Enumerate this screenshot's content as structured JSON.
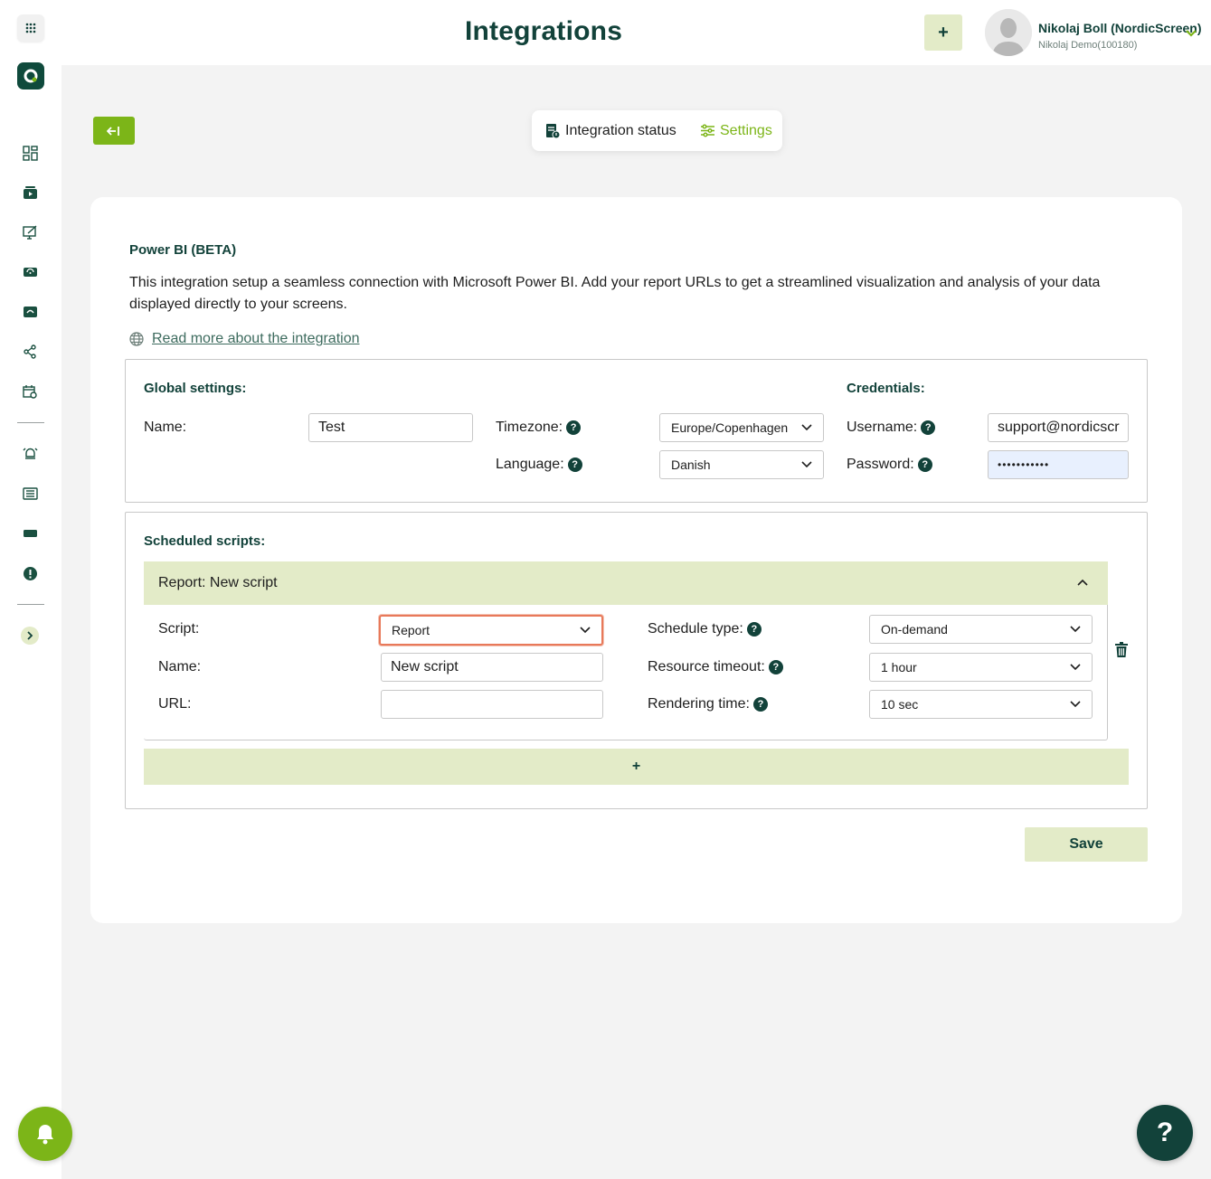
{
  "header": {
    "title": "Integrations",
    "add_label": "+",
    "user_name": "Nikolaj Boll (NordicScreen)",
    "user_sub": "Nikolaj Demo(100180)"
  },
  "tabs": {
    "status_label": "Integration status",
    "settings_label": "Settings"
  },
  "integration": {
    "title": "Power BI (BETA)",
    "description": "This integration setup a seamless connection with Microsoft Power BI. Add your report URLs to get a streamlined visualization and analysis of your data displayed directly to your screens.",
    "read_more": "Read more about the integration"
  },
  "global": {
    "title": "Global settings:",
    "name_label": "Name:",
    "name_value": "Test",
    "timezone_label": "Timezone:",
    "timezone_value": "Europe/Copenhagen",
    "language_label": "Language:",
    "language_value": "Danish"
  },
  "credentials": {
    "title": "Credentials:",
    "username_label": "Username:",
    "username_value": "support@nordicscr",
    "password_label": "Password:",
    "password_value": "•••••••••••"
  },
  "scheduled": {
    "title": "Scheduled scripts:",
    "header_label": "Report:",
    "header_name": "New script",
    "script_label": "Script:",
    "script_value": "Report",
    "name_label": "Name:",
    "name_value": "New script",
    "url_label": "URL:",
    "url_value": "",
    "schedule_type_label": "Schedule type:",
    "schedule_type_value": "On-demand",
    "resource_timeout_label": "Resource timeout:",
    "resource_timeout_value": "1 hour",
    "rendering_time_label": "Rendering time:",
    "rendering_time_value": "10 sec",
    "add_label": "+"
  },
  "save_label": "Save",
  "help_label": "?",
  "colors": {
    "brand_green": "#7cb518",
    "dark_green": "#12423a",
    "light_green": "#e3ebc8",
    "focus_orange": "#e8795a"
  }
}
